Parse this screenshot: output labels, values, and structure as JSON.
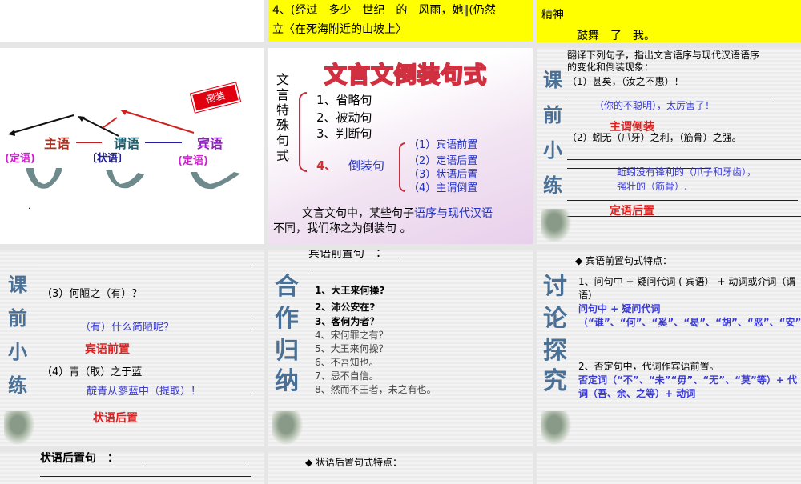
{
  "slides": {
    "s2": {
      "line1": "4、(经过　多少　世纪　的　风雨，她‖(仍然",
      "line2": "立〈在死海附近的山坡上〉"
    },
    "s3": {
      "line1": "精神",
      "line2": "鼓舞　了　我。"
    },
    "s4": {
      "subject": "主语",
      "predicate": "谓语",
      "object": "宾语",
      "attr1": "(定语)",
      "adverbial": "〔状语〕",
      "attr2": "(定语)",
      "stamp": "倒装",
      "dot": "·"
    },
    "s5": {
      "title": "文言文倒装句式",
      "vertical": "文言特殊句式",
      "items": [
        "1、省略句",
        "2、被动句",
        "3、判断句"
      ],
      "item4_num": "4、",
      "item4": "倒装句",
      "sub": [
        "（1）宾语前置",
        "（2）定语后置",
        "（3）状语后置",
        "（4）主谓倒置"
      ],
      "para_a": "文言文句中，某些句子",
      "para_b": "语序与现代汉语",
      "para_c": "不同，我们称之为倒装句 。"
    },
    "s6": {
      "vertical": [
        "课",
        "前",
        "小",
        "练"
      ],
      "intro1": "翻译下列句子，指出文言语序与现代汉语语序",
      "intro2": "的变化和倒装现象：",
      "q1": "（1）甚矣，（汝之不惠）！",
      "a1": "（你的不聪明），太厉害了！",
      "t1": "主谓倒装",
      "q2": "（2）蚓无（爪牙）之利，（筋骨）之强。",
      "a2a": "蚯蚓没有锋利的（爪子和牙齿），",
      "a2b": "强壮的（筋骨）.",
      "t2": "定语后置"
    },
    "s7": {
      "vertical": [
        "课",
        "前",
        "小",
        "练"
      ],
      "q3": "（3）何陋之（有）？",
      "a3": "（有）什么简陋呢？",
      "t3": "宾语前置",
      "q4": "（4）青（取）之于蓝",
      "a4": "靛青从蓼蓝中（提取）！",
      "t4": "状语后置"
    },
    "s8": {
      "vertical": [
        "合",
        "作",
        "归",
        "纳"
      ],
      "header": "宾语前置句　：",
      "items_bold": [
        "1、大王来何操?",
        "2、沛公安在?",
        "3、客何为者？"
      ],
      "items": [
        "4、宋何罪之有？",
        "5、大王来何操？",
        "6、不吾知也。",
        "7、忌不自信。",
        "8、然而不王者，未之有也。"
      ]
    },
    "s9": {
      "vertical": [
        "讨",
        "论",
        "探",
        "究"
      ],
      "header": "◆ 宾语前置句式特点：",
      "p1": "1、问句中 + 疑问代词 ( 宾语） + 动词或介词（谓语）",
      "p1b": "问句中 + 疑问代词（“谁”、“何”、“奚”、“曷”、“胡”、“恶”、“安”、“焉”）",
      "p2": "2、否定句中，代词作宾语前置。",
      "p2b": "否定词（“不”、“未”“毋”、“无”、“莫”等）+ 代词（吾、余、之等）+ 动词"
    },
    "s10": {
      "header": "状语后置句　："
    },
    "s11": {
      "header": "◆ 状语后置句式特点："
    }
  }
}
